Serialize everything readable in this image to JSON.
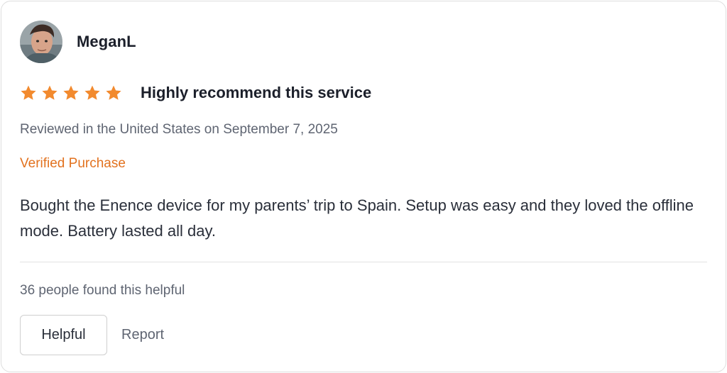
{
  "review": {
    "reviewer": {
      "name": "MeganL",
      "avatar_icon": "user-avatar-photo"
    },
    "rating": {
      "stars": 5,
      "max_stars": 5,
      "star_color": "#f28a2e"
    },
    "title": "Highly recommend this service",
    "meta": "Reviewed in the United States on September 7, 2025",
    "verified_label": "Verified Purchase",
    "verified_color": "#e2721f",
    "body": "Bought the Enence device for my parents’ trip to Spain. Setup was easy and they loved the offline mode. Battery lasted all day.",
    "helpful_count_text": "36 people found this helpful",
    "actions": {
      "helpful_label": "Helpful",
      "report_label": "Report"
    }
  }
}
